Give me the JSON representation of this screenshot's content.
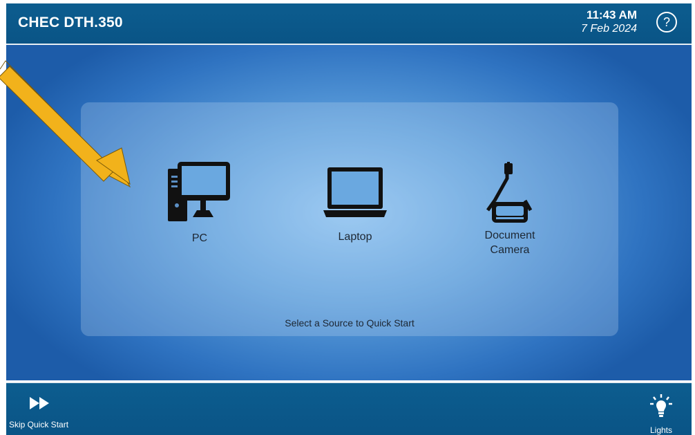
{
  "header": {
    "room_title": "CHEC DTH.350",
    "time": "11:43 AM",
    "date": "7 Feb 2024",
    "help_label": "?"
  },
  "sources": [
    {
      "label": "PC",
      "icon": "desktop-computer-icon"
    },
    {
      "label": "Laptop",
      "icon": "laptop-icon"
    },
    {
      "label": "Document\nCamera",
      "icon": "document-camera-icon"
    }
  ],
  "prompt": "Select a Source to Quick Start",
  "footer": {
    "skip_label": "Skip Quick Start",
    "lights_label": "Lights"
  },
  "colors": {
    "bar": "#0a5486",
    "panel_center": "#8fc4f2",
    "panel_edge": "#1d5ca9",
    "arrow": "#f2b21b"
  }
}
